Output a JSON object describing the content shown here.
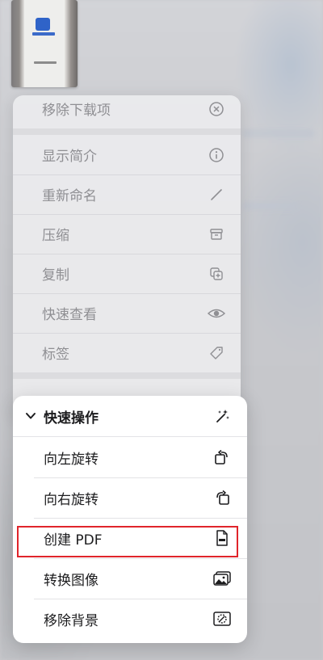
{
  "back_menu": {
    "items": [
      {
        "label": "移除下载项",
        "icon": "close-circle-icon"
      },
      {
        "label": "显示简介",
        "icon": "info-icon"
      },
      {
        "label": "重新命名",
        "icon": "pencil-icon"
      },
      {
        "label": "压缩",
        "icon": "archive-box-icon"
      },
      {
        "label": "复制",
        "icon": "duplicate-icon"
      },
      {
        "label": "快速查看",
        "icon": "eye-icon"
      },
      {
        "label": "标签",
        "icon": "tag-icon"
      }
    ]
  },
  "quick_actions": {
    "header": "快速操作",
    "items": [
      {
        "label": "向左旋转",
        "icon": "rotate-left-icon"
      },
      {
        "label": "向右旋转",
        "icon": "rotate-right-icon"
      },
      {
        "label": "创建 PDF",
        "icon": "pdf-document-icon"
      },
      {
        "label": "转换图像",
        "icon": "photo-icon"
      },
      {
        "label": "移除背景",
        "icon": "remove-background-icon"
      }
    ]
  },
  "colors": {
    "highlight": "#e0242b",
    "menu_text": "#1c1c1e",
    "dim_text": "#8f8f93"
  }
}
